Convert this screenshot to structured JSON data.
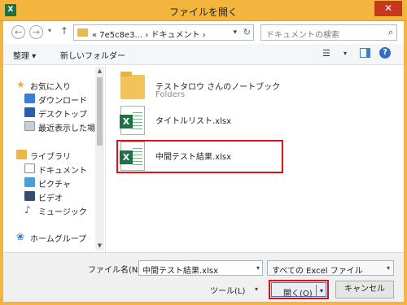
{
  "window": {
    "title": "ファイルを開く",
    "app_icon": "X",
    "close_label": "✕"
  },
  "address_bar": {
    "path": "« 7e5c8e3... › ドキュメント ›",
    "search_placeholder": "ドキュメントの検索"
  },
  "toolbar": {
    "organize_label": "整理 ▾",
    "new_folder_label": "新しいフォルダー"
  },
  "nav_pane": {
    "items": [
      {
        "label": "お気に入り",
        "icon": "star-icon"
      },
      {
        "label": "ダウンロード",
        "icon": "download-folder-icon"
      },
      {
        "label": "デスクトップ",
        "icon": "desktop-icon"
      },
      {
        "label": "最近表示した場所",
        "icon": "recent-places-icon"
      },
      {
        "label": "ライブラリ",
        "icon": "library-icon"
      },
      {
        "label": "ドキュメント",
        "icon": "documents-icon"
      },
      {
        "label": "ピクチャ",
        "icon": "pictures-icon"
      },
      {
        "label": "ビデオ",
        "icon": "videos-icon"
      },
      {
        "label": "ミュージック",
        "icon": "music-icon"
      },
      {
        "label": "ホームグループ",
        "icon": "homegroup-icon"
      }
    ]
  },
  "files": [
    {
      "name": "テストタロウ さんのノートブック",
      "subtitle": "Folders",
      "icon": "notebook-folder-icon"
    },
    {
      "name": "タイトルリスト.xlsx",
      "icon": "excel-file-icon"
    },
    {
      "name": "中間テスト結果.xlsx",
      "icon": "excel-file-icon",
      "selected": true
    }
  ],
  "bottom": {
    "filename_label": "ファイル名(N):",
    "filename_value": "中間テスト結果.xlsx",
    "filter_value": "すべての Excel ファイル",
    "tools_label": "ツール(L)",
    "open_label": "開く(O)",
    "cancel_label": "キャンセル"
  },
  "colors": {
    "title_bar": "#f4b53f",
    "close_button": "#c7371d",
    "highlight": "#e0101a",
    "excel_green": "#1e7145"
  }
}
